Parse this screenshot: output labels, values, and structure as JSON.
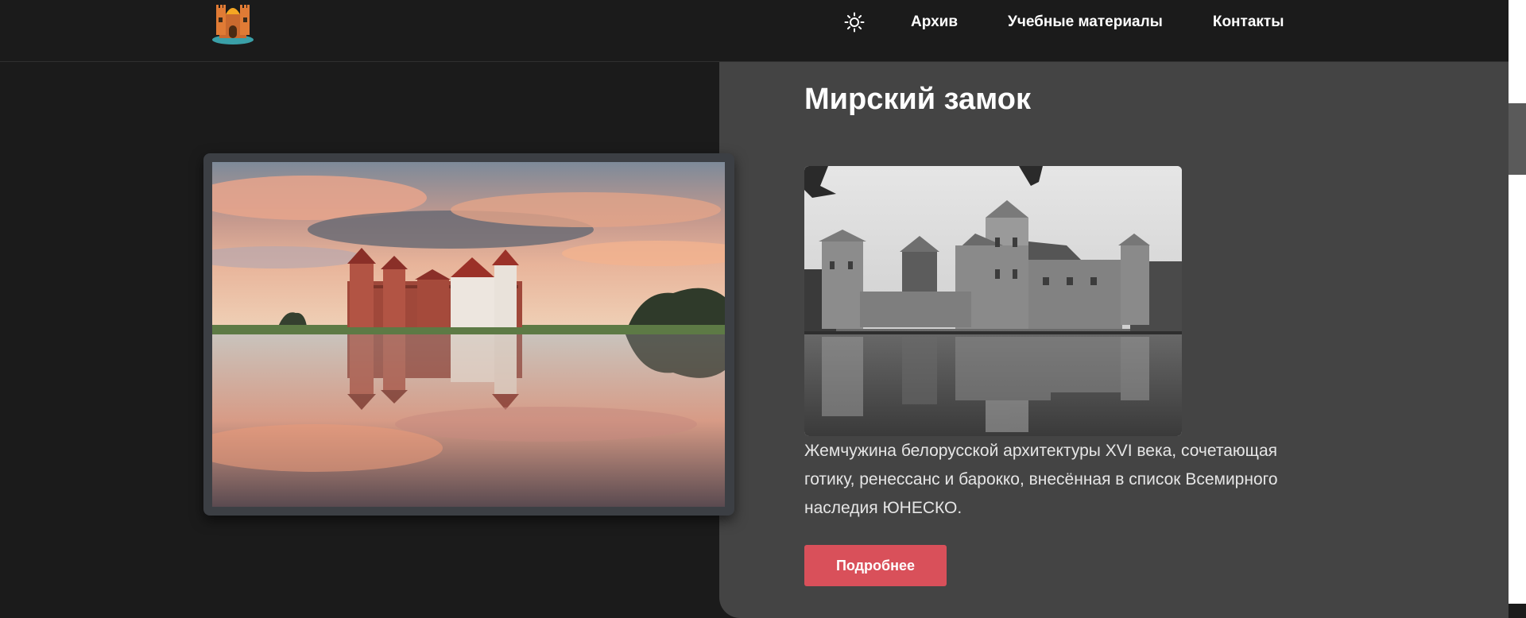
{
  "header": {
    "logo_icon": "castle-logo-icon",
    "theme_toggle_icon": "sun-icon",
    "nav": [
      {
        "label": "Архив"
      },
      {
        "label": "Учебные материалы"
      },
      {
        "label": "Контакты"
      }
    ]
  },
  "feature": {
    "title": "Мирский замок",
    "description": "Жемчужина белорусской архитектуры XVI века, сочетающая готику, ренессанс и барокко, внесённая в список Всемирного наследия ЮНЕСКО.",
    "button_label": "Подробнее"
  },
  "colors": {
    "page_bg": "#1b1b1b",
    "panel_bg": "#444444",
    "accent_button": "#d9505a",
    "photo_frame": "#3c3f44"
  }
}
